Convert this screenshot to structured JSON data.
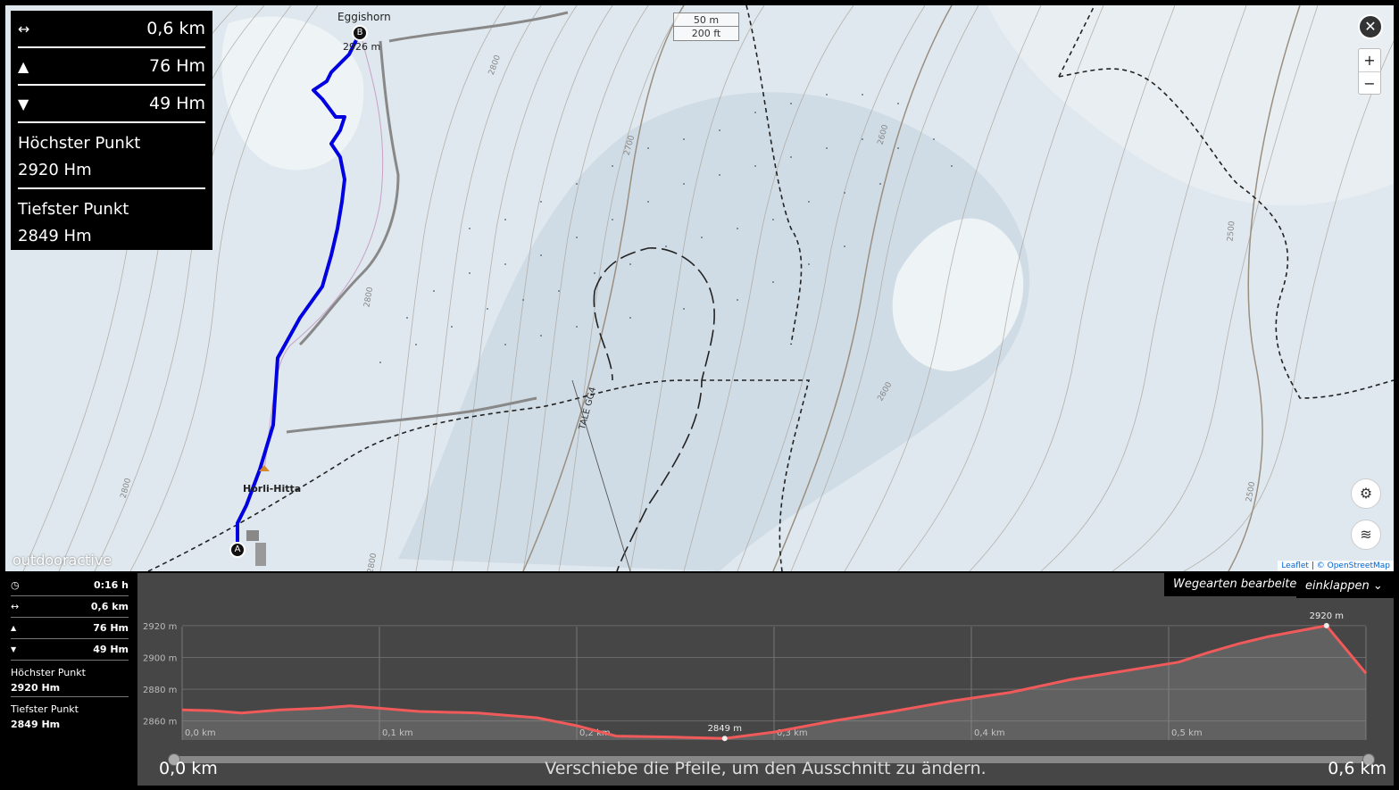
{
  "map": {
    "place_eggishorn": "Eggishorn",
    "place_eggishorn_elev": "2926 m",
    "place_hut": "Horli-Hitta",
    "marker_a": "A",
    "marker_b": "B",
    "contour_labels": [
      "2800",
      "2700",
      "2600",
      "2500",
      "2600",
      "2800",
      "2800",
      "2800",
      "2500"
    ],
    "path_label": "TALE GG4",
    "scale_m": "50 m",
    "scale_ft": "200 ft",
    "brand": "outdooractive",
    "attribution_leaflet": "Leaflet",
    "attribution_osm": "© OpenStreetMap",
    "zoom_in": "+",
    "zoom_out": "−",
    "close_glyph": "✕",
    "route_color": "#0000e0",
    "icons": [
      "close-icon",
      "zoom-in-icon",
      "zoom-out-icon",
      "layers-icon",
      "map-settings-icon",
      "distance-icon",
      "ascent-icon",
      "descent-icon",
      "clock-icon"
    ]
  },
  "stats": {
    "distance": "0,6 km",
    "ascent": "76 Hm",
    "descent": "49 Hm",
    "highest_label": "Höchster Punkt",
    "highest_value": "2920 Hm",
    "lowest_label": "Tiefster Punkt",
    "lowest_value": "2849 Hm"
  },
  "side_stats": {
    "duration": "0:16 h",
    "distance": "0,6 km",
    "ascent": "76 Hm",
    "descent": "49 Hm",
    "highest_label": "Höchster Punkt",
    "highest_value": "2920 Hm",
    "lowest_label": "Tiefster Punkt",
    "lowest_value": "2849 Hm"
  },
  "profile": {
    "btn_edit": "Wegearten bearbeiten",
    "btn_collapse": "einklappen",
    "range_start": "0,0 km",
    "range_end": "0,6 km",
    "range_hint": "Verschiebe die Pfeile, um den Ausschnitt zu ändern.",
    "line_color": "#f05a5a"
  },
  "chart_data": {
    "type": "area",
    "title": "",
    "xlabel": "",
    "ylabel": "",
    "x_unit": "km",
    "y_unit": "m",
    "xlim": [
      0,
      0.6
    ],
    "ylim": [
      2848,
      2925
    ],
    "y_ticks": [
      2860,
      2880,
      2900,
      2920
    ],
    "y_tick_labels": [
      "2860 m",
      "2880 m",
      "2900 m",
      "2920 m"
    ],
    "x_ticks": [
      0,
      0.1,
      0.2,
      0.3,
      0.4,
      0.5
    ],
    "x_tick_labels": [
      "0,0 km",
      "0,1 km",
      "0,2 km",
      "0,3 km",
      "0,4 km",
      "0,5 km"
    ],
    "grid": true,
    "x": [
      0,
      0.015,
      0.03,
      0.05,
      0.07,
      0.085,
      0.1,
      0.12,
      0.15,
      0.18,
      0.2,
      0.22,
      0.25,
      0.275,
      0.3,
      0.33,
      0.36,
      0.39,
      0.42,
      0.45,
      0.475,
      0.49,
      0.505,
      0.52,
      0.535,
      0.55,
      0.565,
      0.58,
      0.6
    ],
    "y": [
      2867,
      2866.5,
      2865,
      2867,
      2868,
      2869.5,
      2868,
      2866,
      2865,
      2862,
      2857,
      2850.5,
      2849.8,
      2849,
      2853,
      2860,
      2866,
      2872.5,
      2878,
      2886,
      2891,
      2894,
      2897,
      2903,
      2908.5,
      2913,
      2916.5,
      2920,
      2890
    ],
    "annotations": [
      {
        "x": 0.275,
        "y": 2849,
        "label": "2849 m"
      },
      {
        "x": 0.58,
        "y": 2920,
        "label": "2920 m"
      }
    ]
  }
}
